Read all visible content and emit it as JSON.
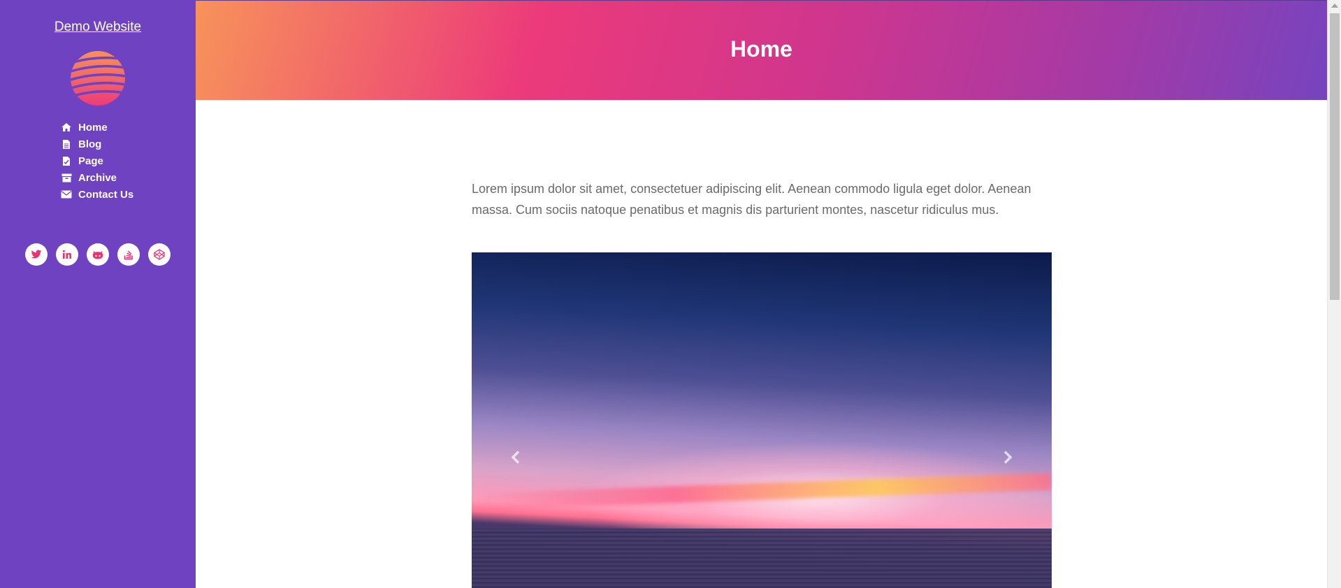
{
  "sidebar": {
    "site_title": "Demo Website",
    "logo_icon": "globe-icon",
    "nav": [
      {
        "label": "Home",
        "icon": "home-icon"
      },
      {
        "label": "Blog",
        "icon": "document-icon"
      },
      {
        "label": "Page",
        "icon": "page-icon"
      },
      {
        "label": "Archive",
        "icon": "archive-icon"
      },
      {
        "label": "Contact Us",
        "icon": "envelope-icon"
      }
    ],
    "social": [
      {
        "icon": "twitter-icon"
      },
      {
        "icon": "linkedin-icon"
      },
      {
        "icon": "github-icon"
      },
      {
        "icon": "stackoverflow-icon"
      },
      {
        "icon": "codepen-icon"
      }
    ]
  },
  "header": {
    "title": "Home"
  },
  "main": {
    "intro": "Lorem ipsum dolor sit amet, consectetuer adipiscing elit. Aenean commodo ligula eget dolor. Aenean massa. Cum sociis natoque penatibus et magnis dis parturient montes, nascetur ridiculus mus.",
    "carousel": {
      "prev_icon": "chevron-left-icon",
      "next_icon": "chevron-right-icon"
    }
  },
  "colors": {
    "sidebar_bg": "#6f42c1",
    "accent": "#e8336f",
    "header_gradient_start": "#f7935a",
    "header_gradient_end": "#7644bf"
  }
}
